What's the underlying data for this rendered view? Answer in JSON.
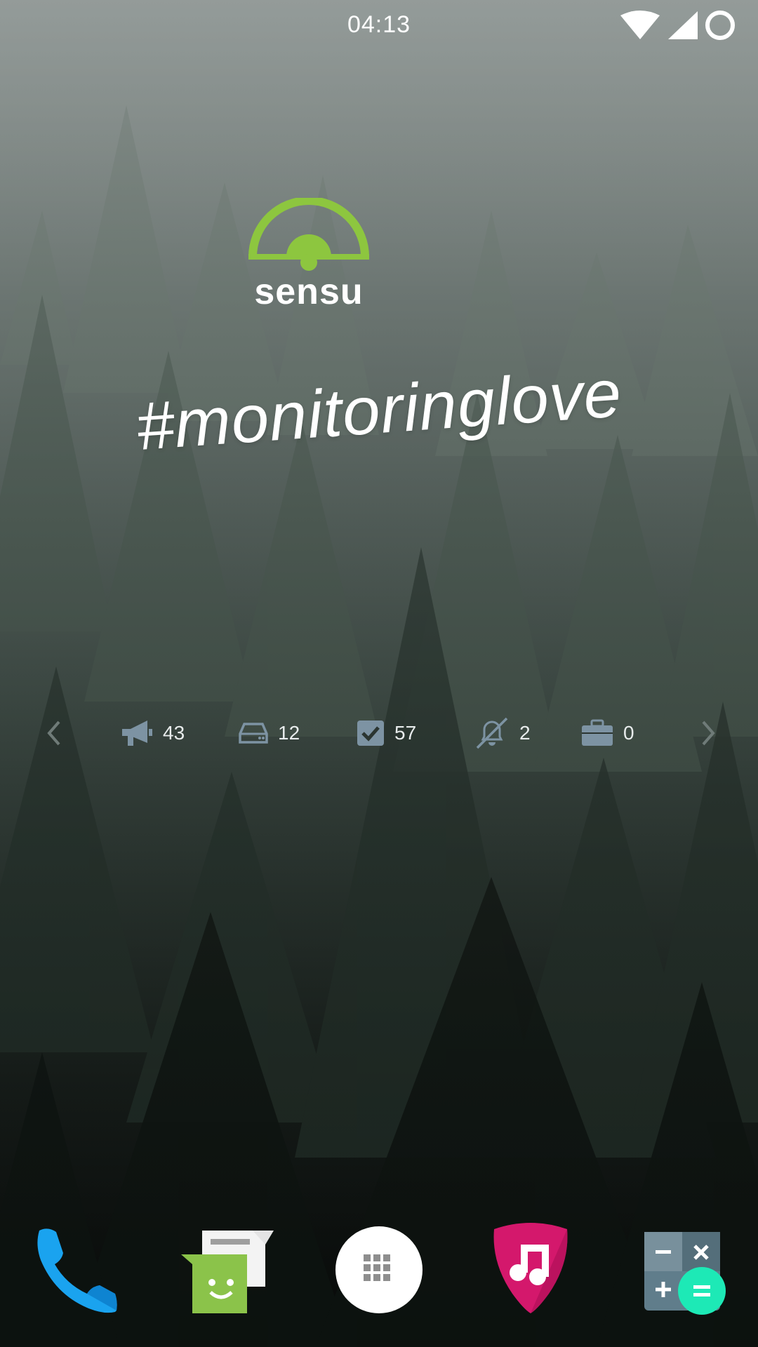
{
  "status_bar": {
    "time": "04:13",
    "icons": [
      "wifi-icon",
      "cell-signal-icon",
      "circle-icon"
    ]
  },
  "widget": {
    "logo_text": "sensu",
    "hashtag": "#monitoringlove",
    "stats": [
      {
        "icon": "megaphone-icon",
        "value": "43"
      },
      {
        "icon": "server-drive-icon",
        "value": "12"
      },
      {
        "icon": "checkbox-icon",
        "value": "57"
      },
      {
        "icon": "bell-muted-icon",
        "value": "2"
      },
      {
        "icon": "briefcase-icon",
        "value": "0"
      }
    ],
    "nav": [
      "chevron-left-icon",
      "chevron-right-icon"
    ]
  },
  "dock": {
    "apps": [
      "phone-icon",
      "messenger-icon",
      "app-drawer-icon",
      "music-icon",
      "calculator-icon"
    ]
  },
  "colors": {
    "sensu_green": "#8dc63f",
    "stat_icon": "#7d93a3",
    "phone_blue": "#1aa3ef",
    "music_pink": "#d4186c",
    "calc_teal": "#1de9b6"
  }
}
